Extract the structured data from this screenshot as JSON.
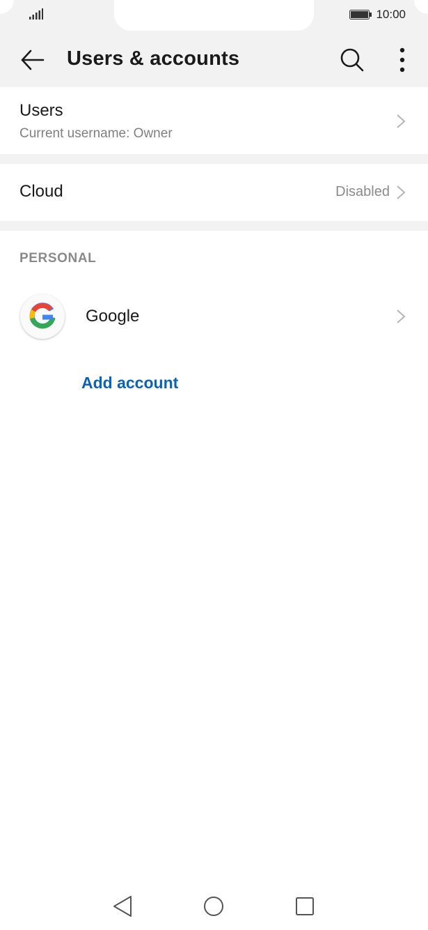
{
  "status_bar": {
    "time": "10:00"
  },
  "app_bar": {
    "title": "Users & accounts",
    "icons": [
      "back-arrow-icon",
      "search-icon",
      "more-vert-icon"
    ]
  },
  "users": {
    "title": "Users",
    "subtitle": "Current username: Owner"
  },
  "cloud": {
    "title": "Cloud",
    "value": "Disabled"
  },
  "personal": {
    "header": "PERSONAL",
    "accounts": [
      {
        "label": "Google",
        "icon": "google-logo-icon"
      }
    ],
    "add_account_label": "Add account"
  },
  "colors": {
    "accent": "#0b63b8",
    "background": "#ffffff",
    "header_bg": "#f2f2f2",
    "secondary_text": "#808080"
  },
  "nav_bar": {
    "icons": [
      "nav-back-icon",
      "nav-home-icon",
      "nav-recents-icon"
    ]
  }
}
